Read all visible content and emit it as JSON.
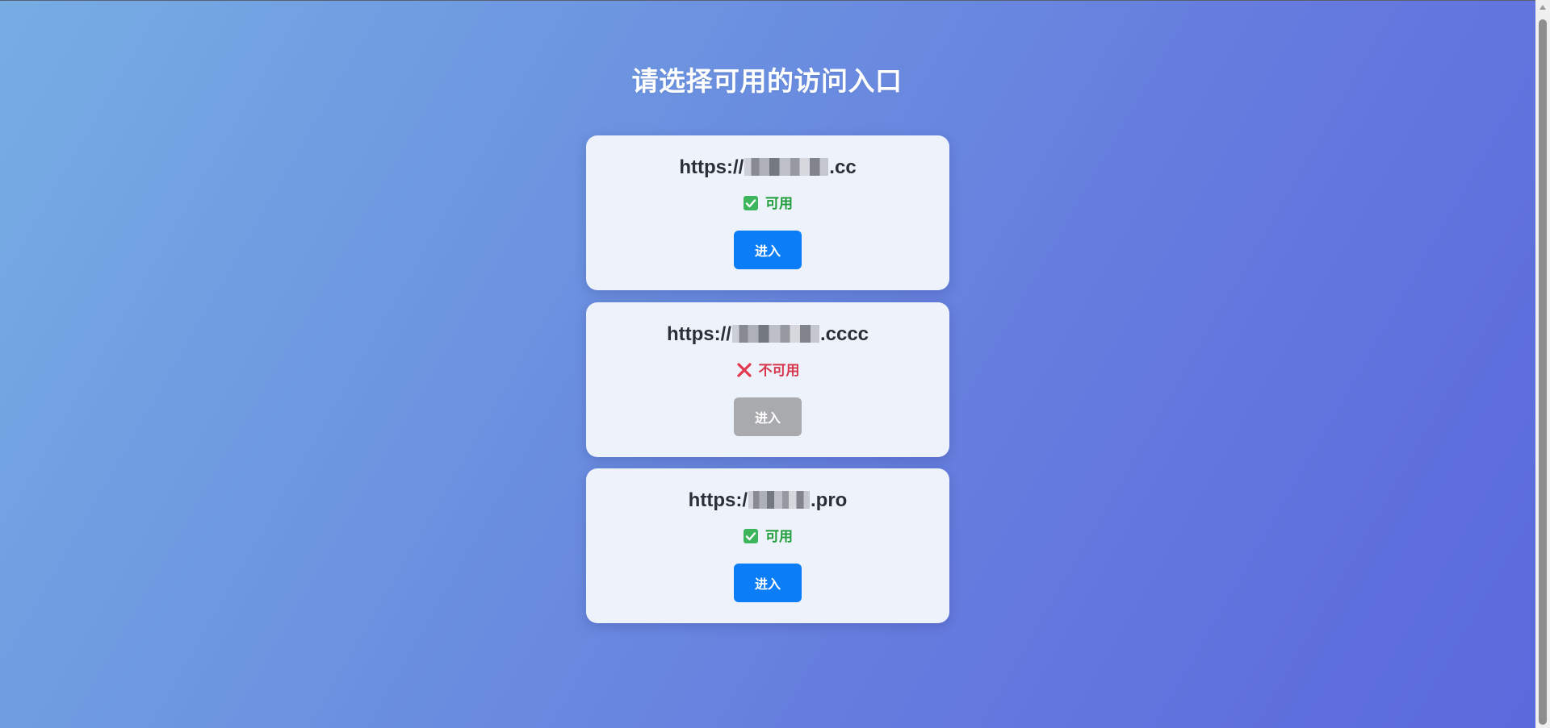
{
  "page": {
    "title": "请选择可用的访问入口"
  },
  "entries": [
    {
      "url_prefix": "https://",
      "url_suffix": ".cc",
      "status_label": "可用",
      "status": "available",
      "status_icon": "check-icon",
      "button_label": "进入",
      "button_enabled": true
    },
    {
      "url_prefix": "https://",
      "url_suffix": ".cccc",
      "status_label": "不可用",
      "status": "unavailable",
      "status_icon": "cross-icon",
      "button_label": "进入",
      "button_enabled": false
    },
    {
      "url_prefix": "https:/",
      "url_suffix": ".pro",
      "status_label": "可用",
      "status": "available",
      "status_icon": "check-icon",
      "button_label": "进入",
      "button_enabled": true
    }
  ],
  "colors": {
    "available": "#1f9d3a",
    "unavailable": "#d63649",
    "button_active": "#0a7df7",
    "button_disabled": "#a9aaad"
  }
}
